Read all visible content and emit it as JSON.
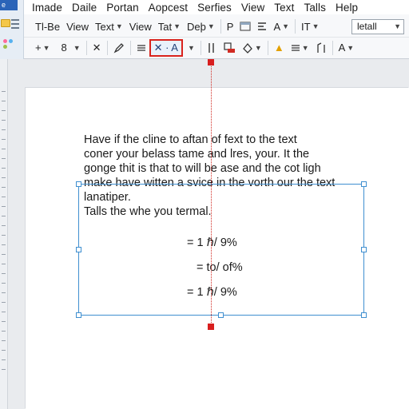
{
  "app": {
    "icon_label": "e"
  },
  "menu": [
    "Imade",
    "Daile",
    "Portan",
    "Aopcest",
    "Serfies",
    "View",
    "Text",
    "Talls",
    "Help"
  ],
  "ribbon": {
    "row1": {
      "btn1": "Tl-Be",
      "btn2": "View",
      "btn3": "Text",
      "btn4": "View",
      "btn5": "Tat",
      "btn6": "Deþ",
      "btn7": "P",
      "btn8": "A",
      "btn9": "IT",
      "style_value": "letall"
    },
    "row2": {
      "plus": "+",
      "size": "8",
      "close": "✕",
      "selected_label": "✕ · A",
      "color_btn": "A"
    }
  },
  "document": {
    "lines": [
      "Have if the cline to aftan of fext to the text",
      "coner your belass tame and lres, your. It the",
      "gonge thit is that to will be ase and the cot ligh",
      "make have witten a svice in the vorth our the text",
      "lanatiper.",
      "Talls the whe you termal."
    ],
    "formulas": [
      "= 1 ℏ/ 9%",
      "= to/ of%",
      "= 1 ℏ/ 9%"
    ]
  },
  "colors": {
    "accent": "#3f8fd0",
    "guide": "#d12a22"
  }
}
